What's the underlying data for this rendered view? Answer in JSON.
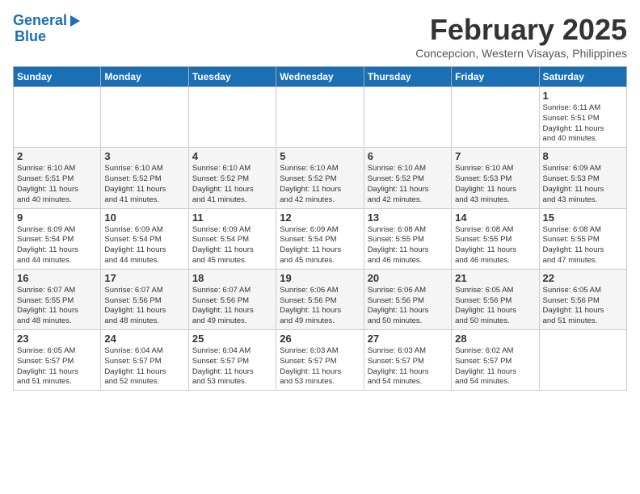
{
  "header": {
    "logo_line1": "General",
    "logo_line2": "Blue",
    "month_year": "February 2025",
    "location": "Concepcion, Western Visayas, Philippines"
  },
  "weekdays": [
    "Sunday",
    "Monday",
    "Tuesday",
    "Wednesday",
    "Thursday",
    "Friday",
    "Saturday"
  ],
  "weeks": [
    [
      {
        "day": "",
        "info": ""
      },
      {
        "day": "",
        "info": ""
      },
      {
        "day": "",
        "info": ""
      },
      {
        "day": "",
        "info": ""
      },
      {
        "day": "",
        "info": ""
      },
      {
        "day": "",
        "info": ""
      },
      {
        "day": "1",
        "info": "Sunrise: 6:11 AM\nSunset: 5:51 PM\nDaylight: 11 hours\nand 40 minutes."
      }
    ],
    [
      {
        "day": "2",
        "info": "Sunrise: 6:10 AM\nSunset: 5:51 PM\nDaylight: 11 hours\nand 40 minutes."
      },
      {
        "day": "3",
        "info": "Sunrise: 6:10 AM\nSunset: 5:52 PM\nDaylight: 11 hours\nand 41 minutes."
      },
      {
        "day": "4",
        "info": "Sunrise: 6:10 AM\nSunset: 5:52 PM\nDaylight: 11 hours\nand 41 minutes."
      },
      {
        "day": "5",
        "info": "Sunrise: 6:10 AM\nSunset: 5:52 PM\nDaylight: 11 hours\nand 42 minutes."
      },
      {
        "day": "6",
        "info": "Sunrise: 6:10 AM\nSunset: 5:52 PM\nDaylight: 11 hours\nand 42 minutes."
      },
      {
        "day": "7",
        "info": "Sunrise: 6:10 AM\nSunset: 5:53 PM\nDaylight: 11 hours\nand 43 minutes."
      },
      {
        "day": "8",
        "info": "Sunrise: 6:09 AM\nSunset: 5:53 PM\nDaylight: 11 hours\nand 43 minutes."
      }
    ],
    [
      {
        "day": "9",
        "info": "Sunrise: 6:09 AM\nSunset: 5:54 PM\nDaylight: 11 hours\nand 44 minutes."
      },
      {
        "day": "10",
        "info": "Sunrise: 6:09 AM\nSunset: 5:54 PM\nDaylight: 11 hours\nand 44 minutes."
      },
      {
        "day": "11",
        "info": "Sunrise: 6:09 AM\nSunset: 5:54 PM\nDaylight: 11 hours\nand 45 minutes."
      },
      {
        "day": "12",
        "info": "Sunrise: 6:09 AM\nSunset: 5:54 PM\nDaylight: 11 hours\nand 45 minutes."
      },
      {
        "day": "13",
        "info": "Sunrise: 6:08 AM\nSunset: 5:55 PM\nDaylight: 11 hours\nand 46 minutes."
      },
      {
        "day": "14",
        "info": "Sunrise: 6:08 AM\nSunset: 5:55 PM\nDaylight: 11 hours\nand 46 minutes."
      },
      {
        "day": "15",
        "info": "Sunrise: 6:08 AM\nSunset: 5:55 PM\nDaylight: 11 hours\nand 47 minutes."
      }
    ],
    [
      {
        "day": "16",
        "info": "Sunrise: 6:07 AM\nSunset: 5:55 PM\nDaylight: 11 hours\nand 48 minutes."
      },
      {
        "day": "17",
        "info": "Sunrise: 6:07 AM\nSunset: 5:56 PM\nDaylight: 11 hours\nand 48 minutes."
      },
      {
        "day": "18",
        "info": "Sunrise: 6:07 AM\nSunset: 5:56 PM\nDaylight: 11 hours\nand 49 minutes."
      },
      {
        "day": "19",
        "info": "Sunrise: 6:06 AM\nSunset: 5:56 PM\nDaylight: 11 hours\nand 49 minutes."
      },
      {
        "day": "20",
        "info": "Sunrise: 6:06 AM\nSunset: 5:56 PM\nDaylight: 11 hours\nand 50 minutes."
      },
      {
        "day": "21",
        "info": "Sunrise: 6:05 AM\nSunset: 5:56 PM\nDaylight: 11 hours\nand 50 minutes."
      },
      {
        "day": "22",
        "info": "Sunrise: 6:05 AM\nSunset: 5:56 PM\nDaylight: 11 hours\nand 51 minutes."
      }
    ],
    [
      {
        "day": "23",
        "info": "Sunrise: 6:05 AM\nSunset: 5:57 PM\nDaylight: 11 hours\nand 51 minutes."
      },
      {
        "day": "24",
        "info": "Sunrise: 6:04 AM\nSunset: 5:57 PM\nDaylight: 11 hours\nand 52 minutes."
      },
      {
        "day": "25",
        "info": "Sunrise: 6:04 AM\nSunset: 5:57 PM\nDaylight: 11 hours\nand 53 minutes."
      },
      {
        "day": "26",
        "info": "Sunrise: 6:03 AM\nSunset: 5:57 PM\nDaylight: 11 hours\nand 53 minutes."
      },
      {
        "day": "27",
        "info": "Sunrise: 6:03 AM\nSunset: 5:57 PM\nDaylight: 11 hours\nand 54 minutes."
      },
      {
        "day": "28",
        "info": "Sunrise: 6:02 AM\nSunset: 5:57 PM\nDaylight: 11 hours\nand 54 minutes."
      },
      {
        "day": "",
        "info": ""
      }
    ]
  ]
}
